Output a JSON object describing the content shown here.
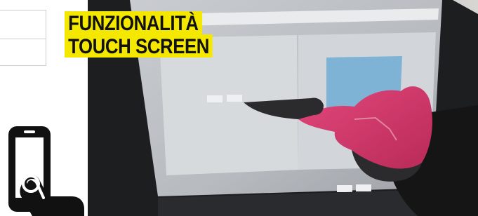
{
  "badge": {
    "line1": "FUNZIONALITÀ",
    "line2": "TOUCH SCREEN",
    "background_color": "#f5e800",
    "text_color": "#111111"
  },
  "icons": {
    "left_icon": "touchscreen-phone-hand-icon"
  },
  "photo": {
    "subject": "gloved-hand-touching-screen",
    "glove_color": "#d63a6a"
  }
}
